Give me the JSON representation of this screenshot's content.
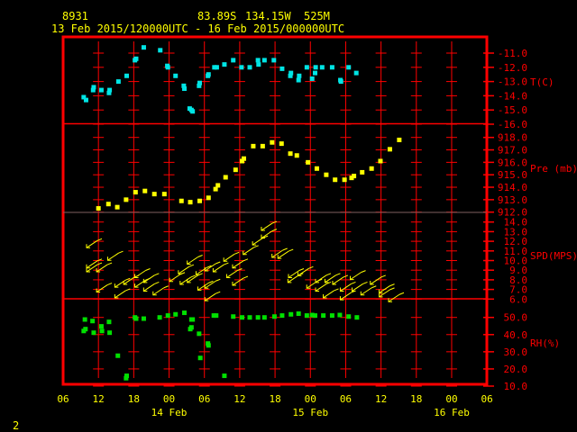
{
  "header": {
    "station": "8931",
    "lat": "83.89S",
    "lon": "134.15W",
    "elev": "525M",
    "period": "13 Feb 2015/120000UTC - 16 Feb 2015/000000UTC"
  },
  "footer": {
    "page": "2"
  },
  "colors": {
    "frame": "#ff0000",
    "text": "#ffff00",
    "temp": "#00e5e5",
    "pres": "#ffff00",
    "wind": "#ffff00",
    "rh": "#00e000"
  },
  "chart_data": {
    "type": "scatter",
    "x_unit": "hours since 13 Feb 2015 06 UTC",
    "x_range": [
      0,
      72
    ],
    "x_ticks": [
      "06",
      "12",
      "18",
      "00",
      "06",
      "12",
      "18",
      "00",
      "06",
      "12",
      "18",
      "00",
      "06"
    ],
    "x_dates": [
      {
        "label": "14 Feb",
        "hour": 18
      },
      {
        "label": "15 Feb",
        "hour": 42
      },
      {
        "label": "16 Feb",
        "hour": 66
      }
    ],
    "panels": [
      {
        "name": "temperature",
        "label": "T(C)",
        "ylim": [
          -16,
          -11
        ],
        "ticks": [
          "-11.0",
          "-12.0",
          "-13.0",
          "-14.0",
          "-15.0",
          "-16.0"
        ],
        "points": [
          [
            3.5,
            -14.1
          ],
          [
            3.9,
            -14.3
          ],
          [
            5.1,
            -13.6
          ],
          [
            5.2,
            -13.4
          ],
          [
            6.5,
            -13.6
          ],
          [
            7.8,
            -13.8
          ],
          [
            7.9,
            -13.6
          ],
          [
            9.4,
            -13.0
          ],
          [
            10.8,
            -12.6
          ],
          [
            12.2,
            -11.5
          ],
          [
            12.4,
            -11.4
          ],
          [
            13.7,
            -10.6
          ],
          [
            16.5,
            -10.8
          ],
          [
            17.7,
            -11.9
          ],
          [
            17.8,
            -12.0
          ],
          [
            19.1,
            -12.6
          ],
          [
            20.5,
            -13.3
          ],
          [
            20.6,
            -13.5
          ],
          [
            21.5,
            -14.9
          ],
          [
            21.8,
            -15.0
          ],
          [
            22.0,
            -15.1
          ],
          [
            23.1,
            -13.3
          ],
          [
            23.2,
            -13.1
          ],
          [
            24.6,
            -12.6
          ],
          [
            24.7,
            -12.5
          ],
          [
            25.7,
            -12.0
          ],
          [
            26.1,
            -12.0
          ],
          [
            27.4,
            -11.8
          ],
          [
            28.9,
            -11.5
          ],
          [
            30.3,
            -12.0
          ],
          [
            31.7,
            -12.0
          ],
          [
            33.1,
            -11.5
          ],
          [
            33.2,
            -11.8
          ],
          [
            34.2,
            -11.5
          ],
          [
            35.8,
            -11.5
          ],
          [
            37.2,
            -12.1
          ],
          [
            38.6,
            -12.6
          ],
          [
            38.7,
            -12.4
          ],
          [
            40.0,
            -12.9
          ],
          [
            40.1,
            -12.6
          ],
          [
            41.4,
            -12.0
          ],
          [
            42.3,
            -12.8
          ],
          [
            42.8,
            -12.4
          ],
          [
            42.9,
            -12.0
          ],
          [
            44.0,
            -12.0
          ],
          [
            45.7,
            -12.0
          ],
          [
            47.1,
            -12.9
          ],
          [
            47.2,
            -13.0
          ],
          [
            48.5,
            -12.0
          ],
          [
            49.8,
            -12.4
          ]
        ]
      },
      {
        "name": "pressure",
        "label": "Pre (mb)",
        "ylim": [
          912,
          918
        ],
        "ticks": [
          "918.0",
          "917.0",
          "916.0",
          "915.0",
          "914.0",
          "913.0",
          "912.0"
        ],
        "points": [
          [
            6.0,
            912.3
          ],
          [
            7.7,
            912.65
          ],
          [
            9.2,
            912.4
          ],
          [
            10.7,
            913.0
          ],
          [
            12.3,
            913.6
          ],
          [
            13.9,
            913.7
          ],
          [
            15.5,
            913.45
          ],
          [
            17.2,
            913.45
          ],
          [
            20.1,
            912.9
          ],
          [
            21.6,
            912.8
          ],
          [
            23.2,
            912.9
          ],
          [
            24.7,
            913.15
          ],
          [
            25.9,
            913.85
          ],
          [
            26.3,
            914.15
          ],
          [
            27.6,
            914.8
          ],
          [
            29.3,
            915.4
          ],
          [
            30.4,
            916.1
          ],
          [
            30.7,
            916.3
          ],
          [
            32.3,
            917.3
          ],
          [
            33.9,
            917.3
          ],
          [
            35.5,
            917.6
          ],
          [
            37.1,
            917.5
          ],
          [
            38.6,
            916.7
          ],
          [
            39.7,
            916.55
          ],
          [
            41.6,
            916.0
          ],
          [
            43.1,
            915.5
          ],
          [
            44.7,
            915.0
          ],
          [
            46.2,
            914.6
          ],
          [
            47.8,
            914.6
          ],
          [
            49.0,
            914.75
          ],
          [
            49.4,
            914.9
          ],
          [
            50.8,
            915.2
          ],
          [
            52.4,
            915.5
          ],
          [
            53.9,
            916.1
          ],
          [
            55.5,
            917.05
          ],
          [
            57.1,
            917.8
          ]
        ]
      },
      {
        "name": "wind_speed",
        "label": "SPD(MPS)",
        "ylim": [
          6,
          14
        ],
        "ticks": [
          "14.0",
          "13.0",
          "12.0",
          "11.0",
          "10.0",
          "9.0",
          "8.0",
          "7.0",
          "6.0"
        ],
        "direction_note": "barbs from NE (arrows point SW)",
        "points": [
          [
            4.9,
            11.7
          ],
          [
            4.9,
            9.6
          ],
          [
            4.9,
            9.2
          ],
          [
            6.6,
            9.2
          ],
          [
            8.5,
            10.4
          ],
          [
            6.6,
            7.1
          ],
          [
            9.7,
            7.6
          ],
          [
            9.7,
            6.5
          ],
          [
            11.2,
            7.9
          ],
          [
            13.1,
            8.6
          ],
          [
            13.1,
            7.6
          ],
          [
            14.6,
            8.1
          ],
          [
            14.6,
            7.2
          ],
          [
            16.2,
            6.8
          ],
          [
            19.0,
            8.2
          ],
          [
            20.5,
            9.0
          ],
          [
            20.8,
            7.9
          ],
          [
            22.0,
            10.0
          ],
          [
            22.0,
            8.1
          ],
          [
            23.5,
            8.9
          ],
          [
            23.8,
            7.3
          ],
          [
            25.0,
            9.3
          ],
          [
            25.0,
            7.5
          ],
          [
            25.0,
            6.2
          ],
          [
            26.4,
            9.2
          ],
          [
            28.2,
            10.3
          ],
          [
            28.7,
            8.6
          ],
          [
            29.7,
            9.6
          ],
          [
            29.7,
            7.8
          ],
          [
            31.5,
            11.0
          ],
          [
            33.1,
            12.0
          ],
          [
            34.6,
            13.5
          ],
          [
            34.6,
            12.7
          ],
          [
            36.4,
            10.7
          ],
          [
            37.4,
            10.6
          ],
          [
            39.2,
            8.6
          ],
          [
            39.1,
            8.1
          ],
          [
            40.8,
            8.8
          ],
          [
            42.3,
            7.5
          ],
          [
            43.8,
            8.1
          ],
          [
            43.8,
            7.2
          ],
          [
            45.1,
            6.5
          ],
          [
            45.4,
            8.1
          ],
          [
            46.7,
            7.9
          ],
          [
            48.0,
            7.2
          ],
          [
            48.0,
            6.3
          ],
          [
            49.7,
            8.4
          ],
          [
            50.0,
            7.2
          ],
          [
            51.5,
            6.8
          ],
          [
            53.1,
            7.9
          ],
          [
            54.6,
            7.0
          ],
          [
            54.6,
            6.6
          ],
          [
            56.2,
            6.1
          ]
        ]
      },
      {
        "name": "relative_humidity",
        "label": "RH(%)",
        "ylim": [
          10,
          50
        ],
        "ticks": [
          "50.0",
          "40.0",
          "30.0",
          "20.0",
          "10.0"
        ],
        "points": [
          [
            3.7,
            48.8
          ],
          [
            3.5,
            42.1
          ],
          [
            3.8,
            43.2
          ],
          [
            5.0,
            47.9
          ],
          [
            5.2,
            41.1
          ],
          [
            6.5,
            44.8
          ],
          [
            6.6,
            42.1
          ],
          [
            7.8,
            47.4
          ],
          [
            7.9,
            41.1
          ],
          [
            9.3,
            27.7
          ],
          [
            10.8,
            16.0
          ],
          [
            10.7,
            14.6
          ],
          [
            12.2,
            50.0
          ],
          [
            12.4,
            49.3
          ],
          [
            13.7,
            49.3
          ],
          [
            16.4,
            50.0
          ],
          [
            17.8,
            51.1
          ],
          [
            19.1,
            51.8
          ],
          [
            20.6,
            52.7
          ],
          [
            21.8,
            48.8
          ],
          [
            22.0,
            48.8
          ],
          [
            21.6,
            43.2
          ],
          [
            21.8,
            44.2
          ],
          [
            23.1,
            40.5
          ],
          [
            24.6,
            34.8
          ],
          [
            24.7,
            33.7
          ],
          [
            23.3,
            26.4
          ],
          [
            25.6,
            51.1
          ],
          [
            26.0,
            51.1
          ],
          [
            27.4,
            16.0
          ],
          [
            28.9,
            50.5
          ],
          [
            30.4,
            50.0
          ],
          [
            31.7,
            50.0
          ],
          [
            33.1,
            50.0
          ],
          [
            34.2,
            50.0
          ],
          [
            35.9,
            50.5
          ],
          [
            37.2,
            51.1
          ],
          [
            38.7,
            51.8
          ],
          [
            40.0,
            52.2
          ],
          [
            41.4,
            51.1
          ],
          [
            42.3,
            51.4
          ],
          [
            42.8,
            51.1
          ],
          [
            44.2,
            51.1
          ],
          [
            45.7,
            51.1
          ],
          [
            47.0,
            51.4
          ],
          [
            48.5,
            50.5
          ],
          [
            49.9,
            50.0
          ]
        ]
      }
    ]
  }
}
